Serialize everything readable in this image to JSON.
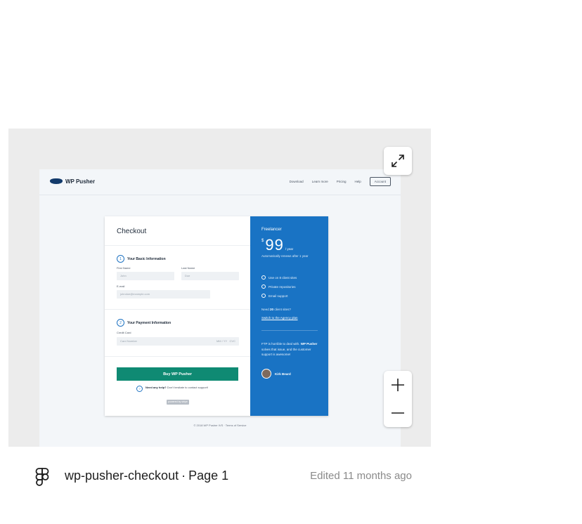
{
  "file": {
    "name": "wp-pusher-checkout",
    "separator": "·",
    "page": "Page 1",
    "edited": "Edited 11 months ago"
  },
  "controls": {
    "expand_icon": "expand-arrows-icon",
    "zoom_in_icon": "plus-icon",
    "zoom_out_icon": "minus-icon"
  },
  "site": {
    "logo": "WP Pusher",
    "nav": [
      "Download",
      "Learn more",
      "Pricing",
      "Help"
    ],
    "account": "Account",
    "footer": "© 2018 WP Pusher IVS · Terms of Service"
  },
  "checkout": {
    "title": "Checkout",
    "step1": {
      "num": "1",
      "title": "Your Basic Information"
    },
    "first_name_label": "First Name",
    "first_name_placeholder": "John",
    "last_name_label": "Last Name",
    "last_name_placeholder": "Doe",
    "email_label": "E-mail",
    "email_placeholder": "johndoe@example.com",
    "step2": {
      "num": "2",
      "title": "Your Payment Information"
    },
    "card_label": "Credit Card",
    "card_placeholder": "Card Number",
    "expiry_placeholder": "MM / YY",
    "cvc_placeholder": "CVC",
    "buy_button": "Buy WP Pusher",
    "help_icon": "?",
    "help_bold": "Need any help?",
    "help_text": "Don't hesitate to contact support!",
    "stripe_badge": "powered by stripe"
  },
  "plan": {
    "name": "Freelancer",
    "currency": "$",
    "price": "99",
    "period": "/ year",
    "renew": "Automatically renews after 1 year",
    "features": [
      "Use on 8 client sites",
      "Private repositories",
      "Email support"
    ],
    "need_prefix": "Need",
    "need_count": "20",
    "need_suffix": "client sites?",
    "switch_link": "Switch to the Agency plan",
    "quote_pre": "FTP is horrible to deal with.",
    "quote_bold": "WP Pusher",
    "quote_post": "solves that issue, and the customer support is awesome!",
    "author": "Kirk Beard"
  },
  "colors": {
    "accent": "#1973c4",
    "button": "#0f8a73",
    "embed_bg": "#ececec"
  }
}
